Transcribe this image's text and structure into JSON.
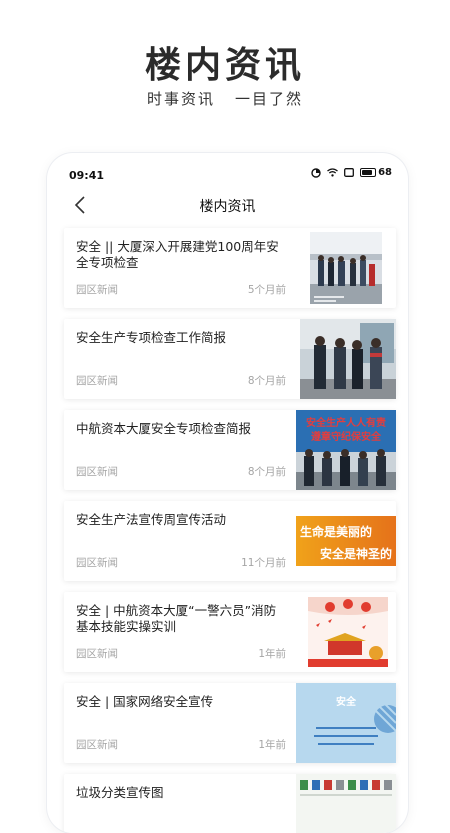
{
  "promo": {
    "title": "楼内资讯",
    "subtitle_left": "时事资讯",
    "subtitle_right": "一目了然"
  },
  "status_bar": {
    "time": "09:41",
    "battery": "68"
  },
  "nav": {
    "title": "楼内资讯"
  },
  "news": [
    {
      "title": "安全 || 大厦深入开展建党100周年安全专项检查",
      "category": "园区新闻",
      "time": "5个月前"
    },
    {
      "title": "安全生产专项检查工作简报",
      "category": "园区新闻",
      "time": "8个月前"
    },
    {
      "title": "中航资本大厦安全专项检查简报",
      "category": "园区新闻",
      "time": "8个月前"
    },
    {
      "title": "安全生产法宣传周宣传活动",
      "category": "园区新闻",
      "time": "11个月前"
    },
    {
      "title": "安全 | 中航资本大厦“一警六员”消防基本技能实操实训",
      "category": "园区新闻",
      "time": "1年前"
    },
    {
      "title": "安全 | 国家网络安全宣传",
      "category": "园区新闻",
      "time": "1年前"
    },
    {
      "title": "垃圾分类宣传图",
      "category": "",
      "time": ""
    }
  ],
  "thumb_text": {
    "board_line1": "安全生产人人有责",
    "board_line2": "遵章守纪保安全",
    "banner_line1": "生命是美丽的",
    "banner_line2": "安全是神圣的",
    "cyber": "安全"
  }
}
